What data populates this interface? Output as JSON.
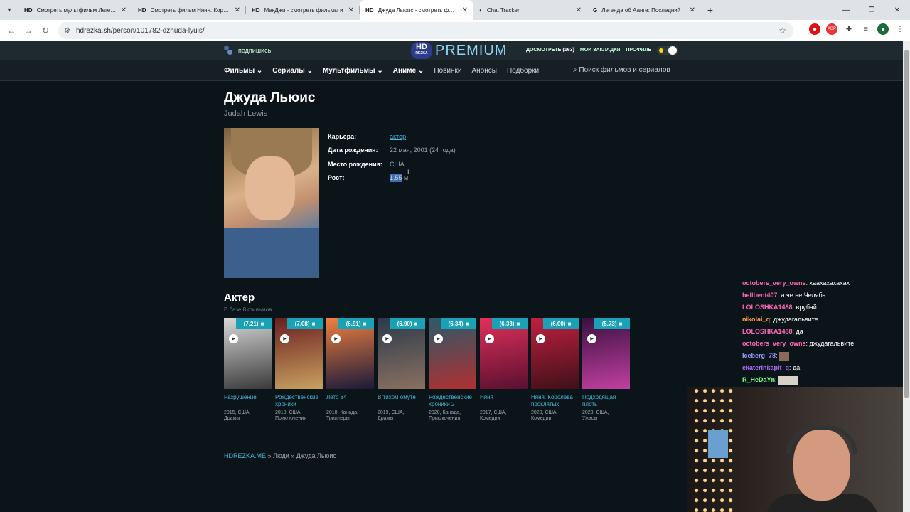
{
  "browser": {
    "tabs": [
      {
        "fav": "HD",
        "title": "Смотреть мультфильм Легенд",
        "active": false
      },
      {
        "fav": "HD",
        "title": "Смотреть фильм Няня. Короле",
        "active": false
      },
      {
        "fav": "HD",
        "title": "МакДжи - смотреть фильмы и",
        "active": false
      },
      {
        "fav": "HD",
        "title": "Джуда Льюис - смотреть филь",
        "active": true
      },
      {
        "fav": "",
        "title": "Chat Tracker",
        "active": false
      },
      {
        "fav": "G",
        "title": "Легенда об Аанге: Последний",
        "active": false
      }
    ],
    "url": "hdrezka.sh/person/101782-dzhuda-lyuis/"
  },
  "site": {
    "subscribe": "подпишись",
    "logo_hd": "HD",
    "logo_sub": "REZKA",
    "logo_premium": "PREMIUM",
    "top_links": {
      "watch_later": "ДОСМОТРЕТЬ",
      "watch_later_count": "(163)",
      "bookmarks": "МОИ ЗАКЛАДКИ",
      "profile": "ПРОФИЛЬ"
    },
    "menu": [
      {
        "label": "Фильмы",
        "dropdown": true
      },
      {
        "label": "Сериалы",
        "dropdown": true
      },
      {
        "label": "Мультфильмы",
        "dropdown": true
      },
      {
        "label": "Аниме",
        "dropdown": true
      },
      {
        "label": "Новинки",
        "dropdown": false
      },
      {
        "label": "Анонсы",
        "dropdown": false
      },
      {
        "label": "Подборки",
        "dropdown": false
      }
    ],
    "search_placeholder": "Поиск фильмов и сериалов"
  },
  "person": {
    "name": "Джуда Льюис",
    "original_name": "Judah Lewis",
    "info": [
      {
        "key": "Карьера:",
        "value": "актер",
        "link": true
      },
      {
        "key": "Дата рождения:",
        "value": "22 мая, 2001 (24 года)",
        "link": false
      },
      {
        "key": "Место рождения:",
        "value": "США",
        "link": false
      },
      {
        "key": "Рост:",
        "value": "1.55",
        "suffix": " м",
        "selected": true
      }
    ]
  },
  "section": {
    "title": "Актер",
    "subtitle": "В базе 8 фильмов"
  },
  "films": [
    {
      "rating": "(7.21)",
      "title": "Разрушение",
      "meta1": "2015, США,",
      "meta2": "Драмы",
      "colors": [
        "#d8d8d8",
        "#3a3a3a"
      ]
    },
    {
      "rating": "(7.08)",
      "title": "Рождественские хроники",
      "meta1": "2018, США,",
      "meta2": "Приключения",
      "colors": [
        "#6a1f1f",
        "#c8a060"
      ]
    },
    {
      "rating": "(6.91)",
      "title": "Лето 84",
      "meta1": "2018, Канада,",
      "meta2": "Триллеры",
      "colors": [
        "#f08040",
        "#1a1a3a"
      ]
    },
    {
      "rating": "(6.90)",
      "title": "В тихом омуте",
      "meta1": "2019, США,",
      "meta2": "Драмы",
      "colors": [
        "#2a3a4a",
        "#8a7060"
      ]
    },
    {
      "rating": "(6.34)",
      "title": "Рождественские хроники 2",
      "meta1": "2020, Канада,",
      "meta2": "Приключения",
      "colors": [
        "#2a5a6a",
        "#b03030"
      ]
    },
    {
      "rating": "(6.33)",
      "title": "Няня",
      "meta1": "2017, США,",
      "meta2": "Комедии",
      "colors": [
        "#e0305a",
        "#5a1030"
      ]
    },
    {
      "rating": "(6.00)",
      "title": "Няня. Королева проклятых",
      "meta1": "2020, США,",
      "meta2": "Комедии",
      "colors": [
        "#c02040",
        "#401018"
      ]
    },
    {
      "rating": "(5.73)",
      "title": "Подходящая плоть",
      "meta1": "2023, США,",
      "meta2": "Ужасы",
      "colors": [
        "#3a1040",
        "#c040a0"
      ]
    }
  ],
  "breadcrumbs": {
    "home": "HDREZKA.ME",
    "sep": " » ",
    "people": "Люди",
    "current": "Джуда Льюис"
  },
  "chat": [
    {
      "user": "octobers_very_owns",
      "color": "#ff69b4",
      "msg": ": хаахахахахах"
    },
    {
      "user": "hellbent407",
      "color": "#ff69b4",
      "msg": ": а че не Челяба"
    },
    {
      "user": "LOLOSHKA1488",
      "color": "#ff69b4",
      "msg": ": врубай"
    },
    {
      "user": "nikolai_q",
      "color": "#ffa040",
      "msg": ": джудагальвите"
    },
    {
      "user": "LOLOSHKA1488",
      "color": "#ff69b4",
      "msg": ": да"
    },
    {
      "user": "octobers_very_owns",
      "color": "#ff69b4",
      "msg": ": джудагальвите"
    },
    {
      "user": "Iceberg_78",
      "color": "#9a9aff",
      "msg": ":",
      "emote": "small"
    },
    {
      "user": "ekaterinkapit_q",
      "color": "#b070ff",
      "msg": ": да"
    },
    {
      "user": "R_HeDaYn",
      "color": "#80ff80",
      "msg": ":",
      "emote": "wide"
    }
  ]
}
